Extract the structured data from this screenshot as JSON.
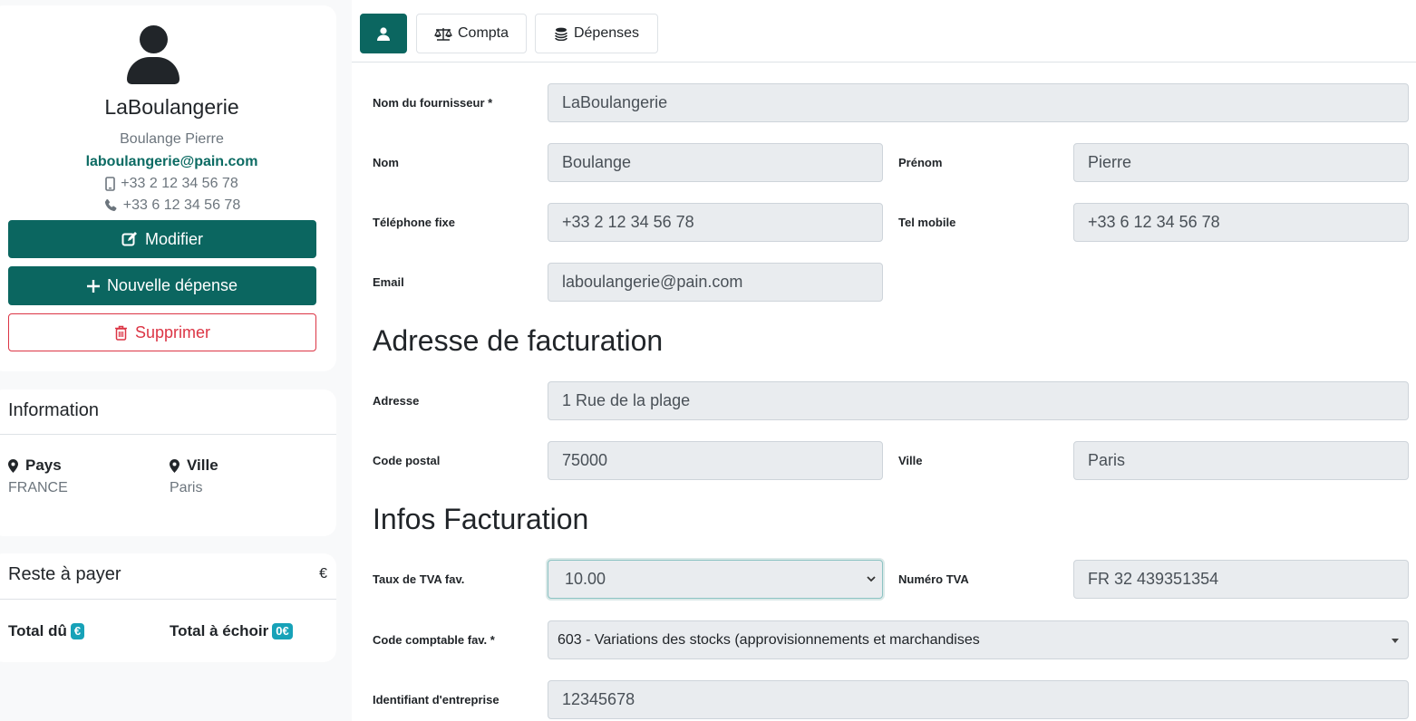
{
  "profile": {
    "company_name": "LaBoulangerie",
    "contact_name": "Boulange Pierre",
    "email": "laboulangerie@pain.com",
    "phone_fixed": "+33 2 12 34 56 78",
    "phone_mobile": "+33 6 12 34 56 78",
    "buttons": {
      "modifier": "Modifier",
      "nouvelle_depense": "Nouvelle dépense",
      "supprimer": "Supprimer"
    }
  },
  "information": {
    "title": "Information",
    "pays_label": "Pays",
    "pays_value": "FRANCE",
    "ville_label": "Ville",
    "ville_value": "Paris"
  },
  "balance": {
    "title": "Reste à payer",
    "currency": "€",
    "total_du_label": "Total dû",
    "total_du_badge": "€",
    "total_echoir_label": "Total à échoir",
    "total_echoir_badge": "0€"
  },
  "tabs": {
    "compta": "Compta",
    "depenses": "Dépenses"
  },
  "form": {
    "fournisseur_label": "Nom du fournisseur *",
    "fournisseur_value": "LaBoulangerie",
    "nom_label": "Nom",
    "nom_value": "Boulange",
    "prenom_label": "Prénom",
    "prenom_value": "Pierre",
    "tel_fixe_label": "Téléphone fixe",
    "tel_fixe_value": "+33 2 12 34 56 78",
    "tel_mobile_label": "Tel mobile",
    "tel_mobile_value": "+33 6 12 34 56 78",
    "email_label": "Email",
    "email_value": "laboulangerie@pain.com",
    "section_adresse": "Adresse de facturation",
    "adresse_label": "Adresse",
    "adresse_value": "1 Rue de la plage",
    "code_postal_label": "Code postal",
    "code_postal_value": "75000",
    "ville_label": "Ville",
    "ville_value": "Paris",
    "section_infos": "Infos Facturation",
    "tva_label": "Taux de TVA fav.",
    "tva_value": "10.00",
    "numero_tva_label": "Numéro TVA",
    "numero_tva_value": "FR 32 439351354",
    "code_comptable_label": "Code comptable fav. *",
    "code_comptable_value": "603 - Variations des stocks (approvisionnements et marchandises",
    "identifiant_label": "Identifiant d'entreprise",
    "identifiant_value": "12345678"
  },
  "colors": {
    "primary": "#0b6660",
    "danger": "#dc3545",
    "badge": "#17a2b8"
  }
}
